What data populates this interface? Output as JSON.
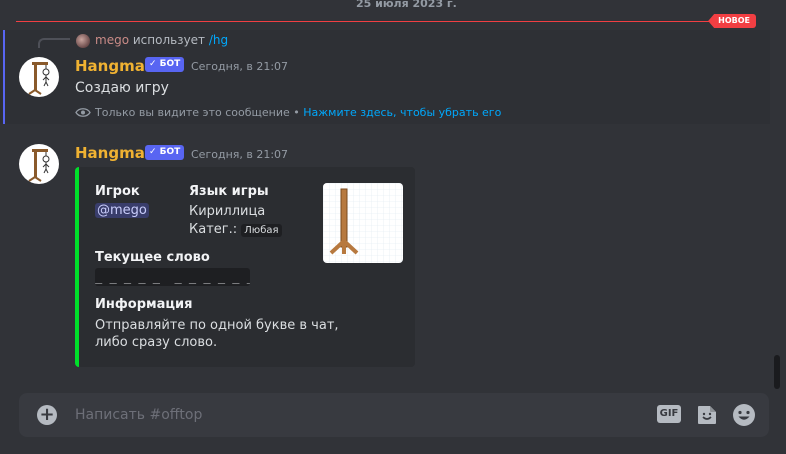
{
  "divider": {
    "date": "25 июля 2023 г.",
    "new_badge": "НОВОЕ"
  },
  "reply": {
    "user": "mego",
    "uses": "использует",
    "command": "/hg"
  },
  "message1": {
    "username": "Hangman",
    "bot_badge": "✓ БОТ",
    "timestamp": "Сегодня, в 21:07",
    "text": "Создаю игру",
    "ephemeral_note": "Только вы видите это сообщение •",
    "dismiss_link": "Нажмите здесь, чтобы убрать его"
  },
  "message2": {
    "username": "Hangman",
    "bot_badge": "✓ БОТ",
    "timestamp": "Сегодня, в 21:07",
    "embed": {
      "accent_color": "#00e02a",
      "player_label": "Игрок",
      "player_value": "@mego",
      "language_label": "Язык игры",
      "language_value": "Кириллица",
      "category_label": "Катег.:",
      "category_value": "Любая",
      "word_label": "Текущее слово",
      "word_value": "_ _ _ _ _  _ _ _ _ _ _",
      "info_label": "Информация",
      "info_line1": "Отправляйте по одной букве в чат,",
      "info_line2": "либо сразу слово."
    }
  },
  "composer": {
    "placeholder": "Написать #offtop",
    "gif_label": "GIF"
  },
  "colors": {
    "username": "#f0b232",
    "bot_badge": "#5865f2",
    "new_line": "#f23f43",
    "link": "#00a8fc"
  }
}
